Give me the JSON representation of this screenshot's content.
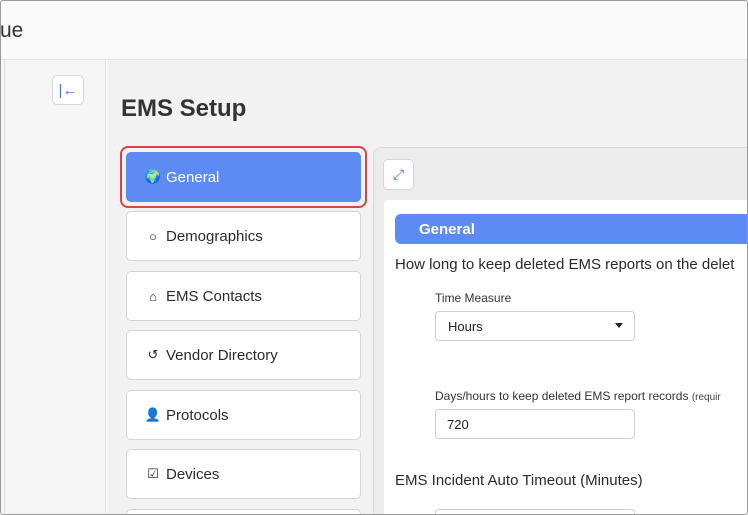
{
  "topbar": {
    "title_fragment": "ue"
  },
  "collapse_button": {
    "icon": "collapse-left-icon",
    "glyph": "|←"
  },
  "page": {
    "title": "EMS Setup"
  },
  "nav": {
    "items": [
      {
        "label": "General",
        "icon": "globe-icon",
        "glyph": "🌍",
        "active": true
      },
      {
        "label": "Demographics",
        "icon": "circle-icon",
        "glyph": "○",
        "active": false
      },
      {
        "label": "EMS Contacts",
        "icon": "home-icon",
        "glyph": "⌂",
        "active": false
      },
      {
        "label": "Vendor Directory",
        "icon": "history-icon",
        "glyph": "↺",
        "active": false
      },
      {
        "label": "Protocols",
        "icon": "user-icon",
        "glyph": "👤",
        "active": false
      },
      {
        "label": "Devices",
        "icon": "checkbox-icon",
        "glyph": "☑",
        "active": false
      }
    ]
  },
  "panel": {
    "expand_icon": "expand-icon",
    "expand_glyph": "⤢",
    "section_title": "General",
    "question": "How long to keep deleted EMS reports on the delet",
    "time_measure": {
      "label": "Time Measure",
      "value": "Hours"
    },
    "days_hours": {
      "label": "Days/hours to keep deleted EMS report records",
      "required_hint": "(requir",
      "value": "720"
    },
    "auto_timeout": {
      "label": "EMS Incident Auto Timeout (Minutes)"
    }
  },
  "colors": {
    "accent": "#5d8bf4",
    "highlight": "#e0404a"
  }
}
